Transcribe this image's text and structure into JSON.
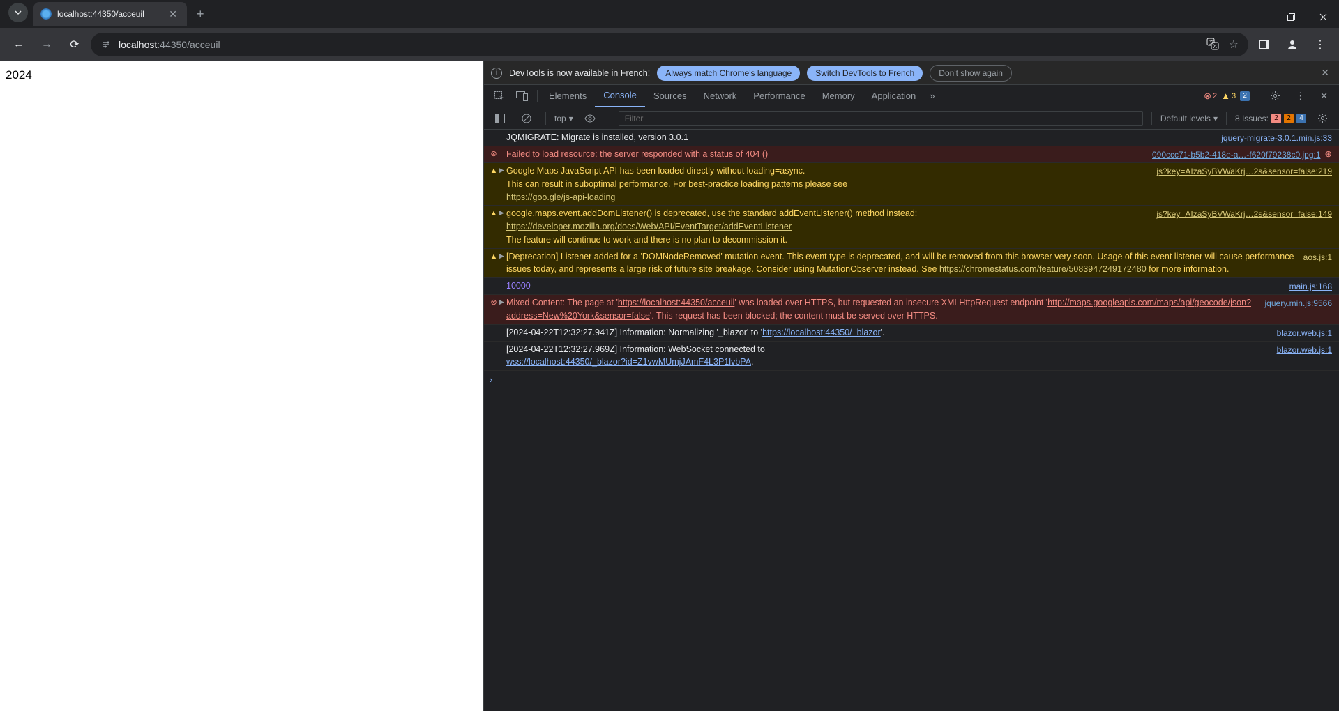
{
  "browser": {
    "tab_title": "localhost:44350/acceuil",
    "url_host": "localhost",
    "url_port": ":44350",
    "url_path": "/acceuil"
  },
  "page": {
    "body_text": "2024"
  },
  "infobar": {
    "text": "DevTools is now available in French!",
    "btn_match": "Always match Chrome's language",
    "btn_switch": "Switch DevTools to French",
    "btn_dismiss": "Don't show again"
  },
  "tabs": {
    "elements": "Elements",
    "console": "Console",
    "sources": "Sources",
    "network": "Network",
    "performance": "Performance",
    "memory": "Memory",
    "application": "Application"
  },
  "counts": {
    "errors": "2",
    "warnings": "3",
    "info": "2"
  },
  "ctoolbar": {
    "context": "top",
    "filter_ph": "Filter",
    "levels": "Default levels",
    "issues_label": "8 Issues:",
    "issues_red": "2",
    "issues_orange": "2",
    "issues_blue": "4"
  },
  "log": {
    "r0": {
      "msg": "JQMIGRATE: Migrate is installed, version 3.0.1",
      "src": "jquery-migrate-3.0.1.min.js:33"
    },
    "r1": {
      "msg": "Failed to load resource: the server responded with a status of 404 ()",
      "src": "090ccc71-b5b2-418e-a…-f620f79238c0.jpg:1"
    },
    "r2": {
      "pre": "Google Maps JavaScript API has been loaded directly without loading=async. ",
      "post1": "This can result in suboptimal performance. For best-practice loading patterns please see ",
      "link": "https://goo.gle/js-api-loading",
      "src": "js?key=AIzaSyBVWaKrj…2s&sensor=false:219"
    },
    "r3": {
      "pre": "google.maps.event.addDomListener() is deprecated, use the standard addEventListener() method instead: ",
      "link": "https://developer.mozilla.org/docs/Web/API/EventTarget/addEventListener",
      "post": "The feature will continue to work and there is no plan to decommission it.",
      "src": "js?key=AIzaSyBVWaKrj…2s&sensor=false:149"
    },
    "r4": {
      "pre": "[Deprecation] Listener added for a 'DOMNodeRemoved' mutation event. This event type is deprecated, and will be removed from this browser very soon. Usage of this event listener will cause performance issues today, and represents a large risk of future site breakage. Consider using MutationObserver instead. See ",
      "link": "https://chromestatus.com/feature/5083947249172480",
      "post": " for more information.",
      "src": "aos.js:1"
    },
    "r5": {
      "msg": "10000",
      "src": "main.js:168"
    },
    "r6": {
      "pre": "Mixed Content: The page at '",
      "link1": "https://localhost:44350/acceuil",
      "mid": "' was loaded over HTTPS, but requested an insecure XMLHttpRequest endpoint '",
      "link2": "http://maps.googleapis.com/maps/api/geocode/json?address=New%20York&sensor=false",
      "post": "'. This request has been blocked; the content must be served over HTTPS.",
      "src": "jquery.min.js:9566"
    },
    "r7": {
      "pre": "[2024-04-22T12:32:27.941Z] Information: Normalizing '_blazor' to '",
      "link": "https://localhost:44350/_blazor",
      "post": "'.",
      "src": "blazor.web.js:1"
    },
    "r8": {
      "pre": "[2024-04-22T12:32:27.969Z] Information: WebSocket connected to ",
      "link": "wss://localhost:44350/_blazor?id=Z1vwMUmjJAmF4L3P1lvbPA",
      "post": ".",
      "src": "blazor.web.js:1"
    }
  }
}
